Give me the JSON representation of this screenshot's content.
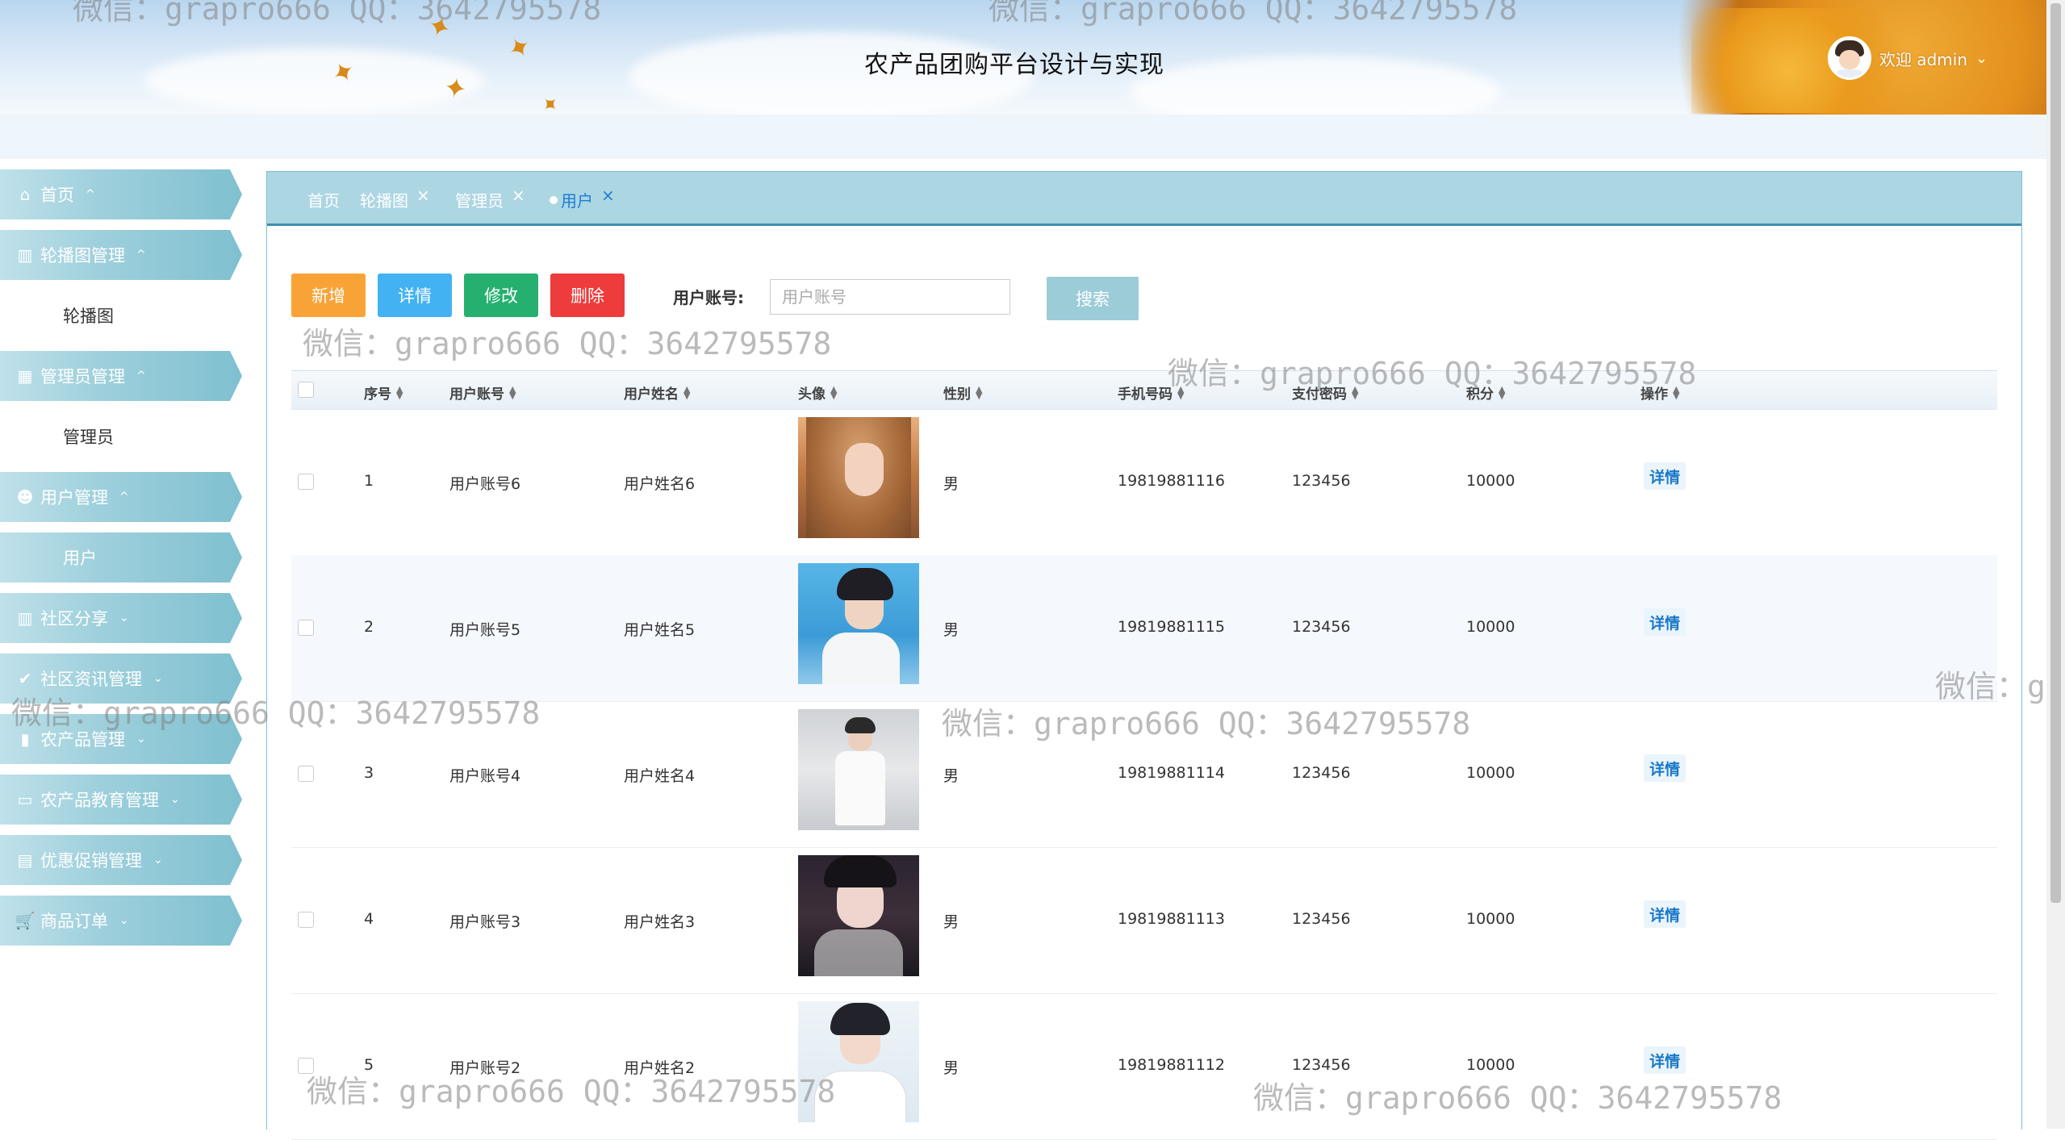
{
  "header": {
    "title": "农产品团购平台设计与实现",
    "welcome": "欢迎 admin",
    "caret": "⌄"
  },
  "watermark": "微信：grapro666 QQ：3642795578",
  "sidebar": {
    "items": [
      {
        "label": "首页",
        "icon": "home-icon",
        "caret": "^",
        "type": "menu"
      },
      {
        "label": "轮播图管理",
        "icon": "chart-icon",
        "caret": "^",
        "type": "menu"
      },
      {
        "label": "轮播图",
        "type": "sub"
      },
      {
        "label": "管理员管理",
        "icon": "grid-icon",
        "caret": "^",
        "type": "menu"
      },
      {
        "label": "管理员",
        "type": "sub"
      },
      {
        "label": "用户管理",
        "icon": "user-icon",
        "caret": "^",
        "type": "menu"
      },
      {
        "label": "用户",
        "type": "sub",
        "active": true
      },
      {
        "label": "社区分享",
        "icon": "chart-icon",
        "caret": "⌄",
        "type": "menu"
      },
      {
        "label": "社区资讯管理",
        "icon": "check-icon",
        "caret": "⌄",
        "type": "menu"
      },
      {
        "label": "农产品管理",
        "icon": "bookmark-icon",
        "caret": "⌄",
        "type": "menu"
      },
      {
        "label": "农产品教育管理",
        "icon": "layout-icon",
        "caret": "⌄",
        "type": "menu"
      },
      {
        "label": "优惠促销管理",
        "icon": "box-icon",
        "caret": "⌄",
        "type": "menu"
      },
      {
        "label": "商品订单",
        "icon": "cart-icon",
        "caret": "⌄",
        "type": "menu"
      }
    ]
  },
  "tabs": [
    {
      "label": "首页",
      "closable": false
    },
    {
      "label": "轮播图",
      "closable": true
    },
    {
      "label": "管理员",
      "closable": true
    },
    {
      "label": "用户",
      "closable": true,
      "active": true
    }
  ],
  "toolbar": {
    "add": "新增",
    "detail": "详情",
    "edit": "修改",
    "delete": "删除",
    "search_label": "用户账号:",
    "search_placeholder": "用户账号",
    "search_button": "搜索"
  },
  "table": {
    "columns": [
      "序号",
      "用户账号",
      "用户姓名",
      "头像",
      "性别",
      "手机号码",
      "支付密码",
      "积分",
      "操作"
    ],
    "rows": [
      {
        "index": "1",
        "account": "用户账号6",
        "name": "用户姓名6",
        "gender": "男",
        "phone": "19819881116",
        "pay_password": "123456",
        "points": "10000",
        "action": "详情"
      },
      {
        "index": "2",
        "account": "用户账号5",
        "name": "用户姓名5",
        "gender": "男",
        "phone": "19819881115",
        "pay_password": "123456",
        "points": "10000",
        "action": "详情"
      },
      {
        "index": "3",
        "account": "用户账号4",
        "name": "用户姓名4",
        "gender": "男",
        "phone": "19819881114",
        "pay_password": "123456",
        "points": "10000",
        "action": "详情"
      },
      {
        "index": "4",
        "account": "用户账号3",
        "name": "用户姓名3",
        "gender": "男",
        "phone": "19819881113",
        "pay_password": "123456",
        "points": "10000",
        "action": "详情"
      },
      {
        "index": "5",
        "account": "用户账号2",
        "name": "用户姓名2",
        "gender": "男",
        "phone": "19819881112",
        "pay_password": "123456",
        "points": "10000",
        "action": "详情"
      }
    ]
  },
  "colors": {
    "accent": "#7fc0d0",
    "tab_bar": "#add6e3",
    "add": "#f9a336",
    "detail": "#43b2f3",
    "edit": "#26b06f",
    "delete": "#ee3b3b",
    "search": "#9dccd9"
  }
}
